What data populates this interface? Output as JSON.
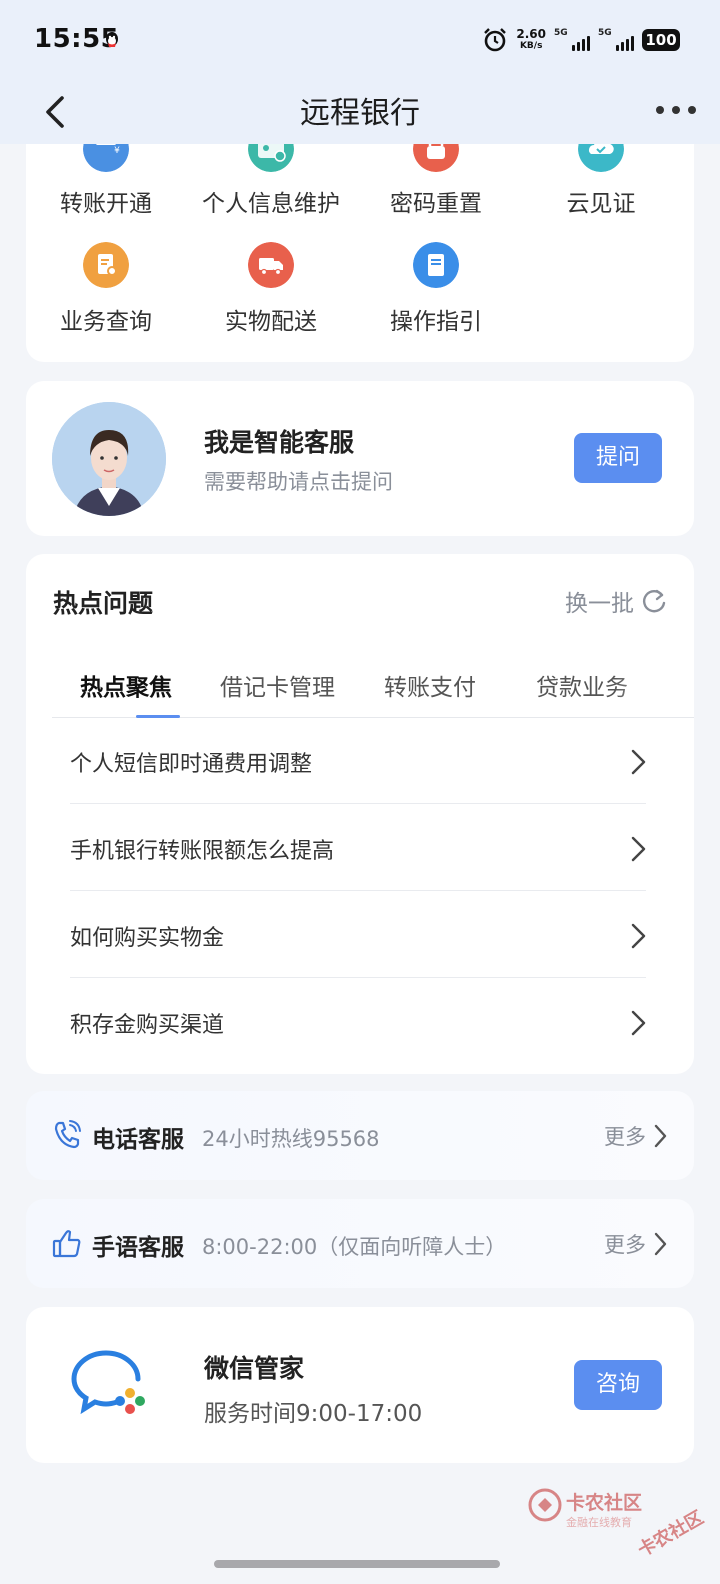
{
  "status_bar": {
    "time": "15:55",
    "net_speed": "2.60",
    "net_unit": "KB/s",
    "signal_1": "5G",
    "signal_2": "5G",
    "battery": "100"
  },
  "nav": {
    "title": "远程银行"
  },
  "quick_menu": {
    "items": [
      {
        "label": "转账开通",
        "icon": "transfer-icon",
        "color": "#4a90e2"
      },
      {
        "label": "个人信息维护",
        "icon": "profile-icon",
        "color": "#3cb8a8"
      },
      {
        "label": "密码重置",
        "icon": "lock-icon",
        "color": "#e8604c"
      },
      {
        "label": "云见证",
        "icon": "cloud-icon",
        "color": "#3cb8c8"
      },
      {
        "label": "业务查询",
        "icon": "search-doc-icon",
        "color": "#f0a040"
      },
      {
        "label": "实物配送",
        "icon": "truck-icon",
        "color": "#e8604c"
      },
      {
        "label": "操作指引",
        "icon": "guide-icon",
        "color": "#3a8ee8"
      }
    ]
  },
  "ai_service": {
    "title": "我是智能客服",
    "subtitle": "需要帮助请点击提问",
    "button": "提问"
  },
  "hot_questions": {
    "title": "热点问题",
    "refresh_label": "换一批",
    "tabs": [
      "热点聚焦",
      "借记卡管理",
      "转账支付",
      "贷款业务"
    ],
    "active_tab": 0,
    "questions": [
      "个人短信即时通费用调整",
      "手机银行转账限额怎么提高",
      "如何购买实物金",
      "积存金购买渠道"
    ]
  },
  "phone_service": {
    "title": "电话客服",
    "subtitle": "24小时热线95568",
    "more": "更多"
  },
  "sign_service": {
    "title": "手语客服",
    "subtitle": "8:00-22:00（仅面向听障人士）",
    "more": "更多"
  },
  "wechat": {
    "title": "微信管家",
    "subtitle": "服务时间9:00-17:00",
    "button": "咨询"
  },
  "watermark": {
    "text": "卡农社区",
    "sub": "金融在线教育",
    "text2": "卡农社区"
  },
  "colors": {
    "accent": "#5b8ef0",
    "nav_bg": "#eaf0fa",
    "page_bg": "#f3f5f9"
  }
}
